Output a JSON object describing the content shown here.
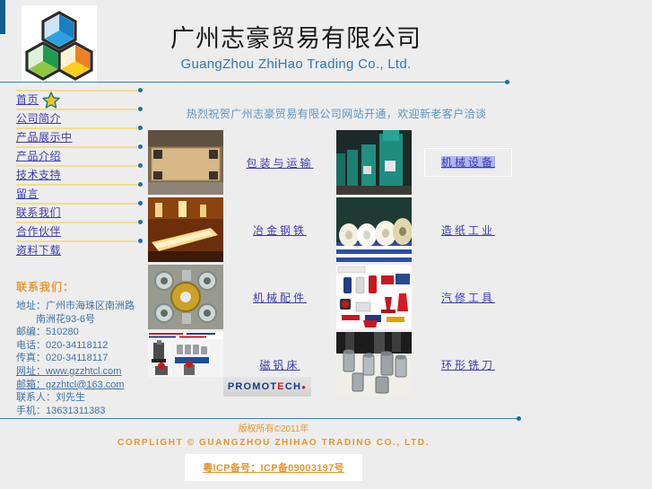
{
  "header": {
    "logo_alt": "company-logo",
    "title_cn": "广州志豪贸易有限公司",
    "title_en": "GuangZhou ZhiHao Trading Co., Ltd."
  },
  "sidebar": {
    "items": [
      {
        "label": "首页",
        "icon": "star-icon"
      },
      {
        "label": "公司简介",
        "icon": ""
      },
      {
        "label": "产品展示中",
        "icon": ""
      },
      {
        "label": "产品介绍",
        "icon": ""
      },
      {
        "label": "技术支持",
        "icon": ""
      },
      {
        "label": "留言",
        "icon": ""
      },
      {
        "label": "联系我们",
        "icon": ""
      },
      {
        "label": "合作伙伴",
        "icon": ""
      },
      {
        "label": "资料下载",
        "icon": ""
      }
    ]
  },
  "contact": {
    "title": "联系我们：",
    "lines": [
      {
        "text": "地址：广州市海珠区南洲路",
        "indent": false
      },
      {
        "text": "南洲花93-6号",
        "indent": true
      },
      {
        "text": "邮编：510280",
        "indent": false
      },
      {
        "text": "电话：020-34118112",
        "indent": false
      },
      {
        "text": "传真：020-34118117",
        "indent": false
      },
      {
        "text": "网址：www.gzzhtcl.com",
        "indent": false,
        "link": true
      },
      {
        "text": "邮箱：gzzhtcl@163.com",
        "indent": false,
        "link": true
      },
      {
        "text": "联系人：刘先生",
        "indent": false
      },
      {
        "text": "手机：13631311383",
        "indent": false
      }
    ]
  },
  "main": {
    "heading": "热烈祝贺广州志豪贸易有限公司网站开通，欢迎新老客户洽谈",
    "rows": [
      {
        "cells": [
          {
            "thumb": "wooden-crate-photo",
            "label": "包装与运输",
            "focused": false
          },
          {
            "thumb": "green-machinery-photo",
            "label": "机械设备",
            "focused": true
          }
        ]
      },
      {
        "cells": [
          {
            "thumb": "steel-mill-photo",
            "label": "冶金钢铁",
            "focused": false
          },
          {
            "thumb": "paper-rolls-photo",
            "label": "造纸工业",
            "focused": false
          }
        ]
      },
      {
        "cells": [
          {
            "thumb": "castings-bearings-photo",
            "label": "机械配件",
            "focused": false
          },
          {
            "thumb": "jacks-tools-photo",
            "label": "汽修工具",
            "focused": false
          }
        ]
      },
      {
        "cells": [
          {
            "thumb": "magnetic-drill-photo",
            "label": "磁钒床",
            "focused": false,
            "brand": "PROMOTECH"
          },
          {
            "thumb": "annular-cutters-photo",
            "label": "环形铣刀",
            "focused": false
          }
        ]
      }
    ]
  },
  "footer": {
    "copyright_cn": "版权所有©2011年",
    "copyright_en": "CORPLIGHT © GUANGZHOU ZHIHAO TRADING CO., LTD.",
    "icp": "粵ICP备号：ICP备09003197号"
  },
  "colors": {
    "page_bg": "#ededed",
    "accent_blue": "#0b5f91",
    "rule_blue": "#3c7fb1",
    "rule_gold": "#f5dc8a",
    "link_blue": "#3b3bb5",
    "contact_blue": "#3f73a6",
    "orange": "#e8952f",
    "heading_blue": "#5b95c0",
    "focus_highlight": "#aeb3f2"
  }
}
